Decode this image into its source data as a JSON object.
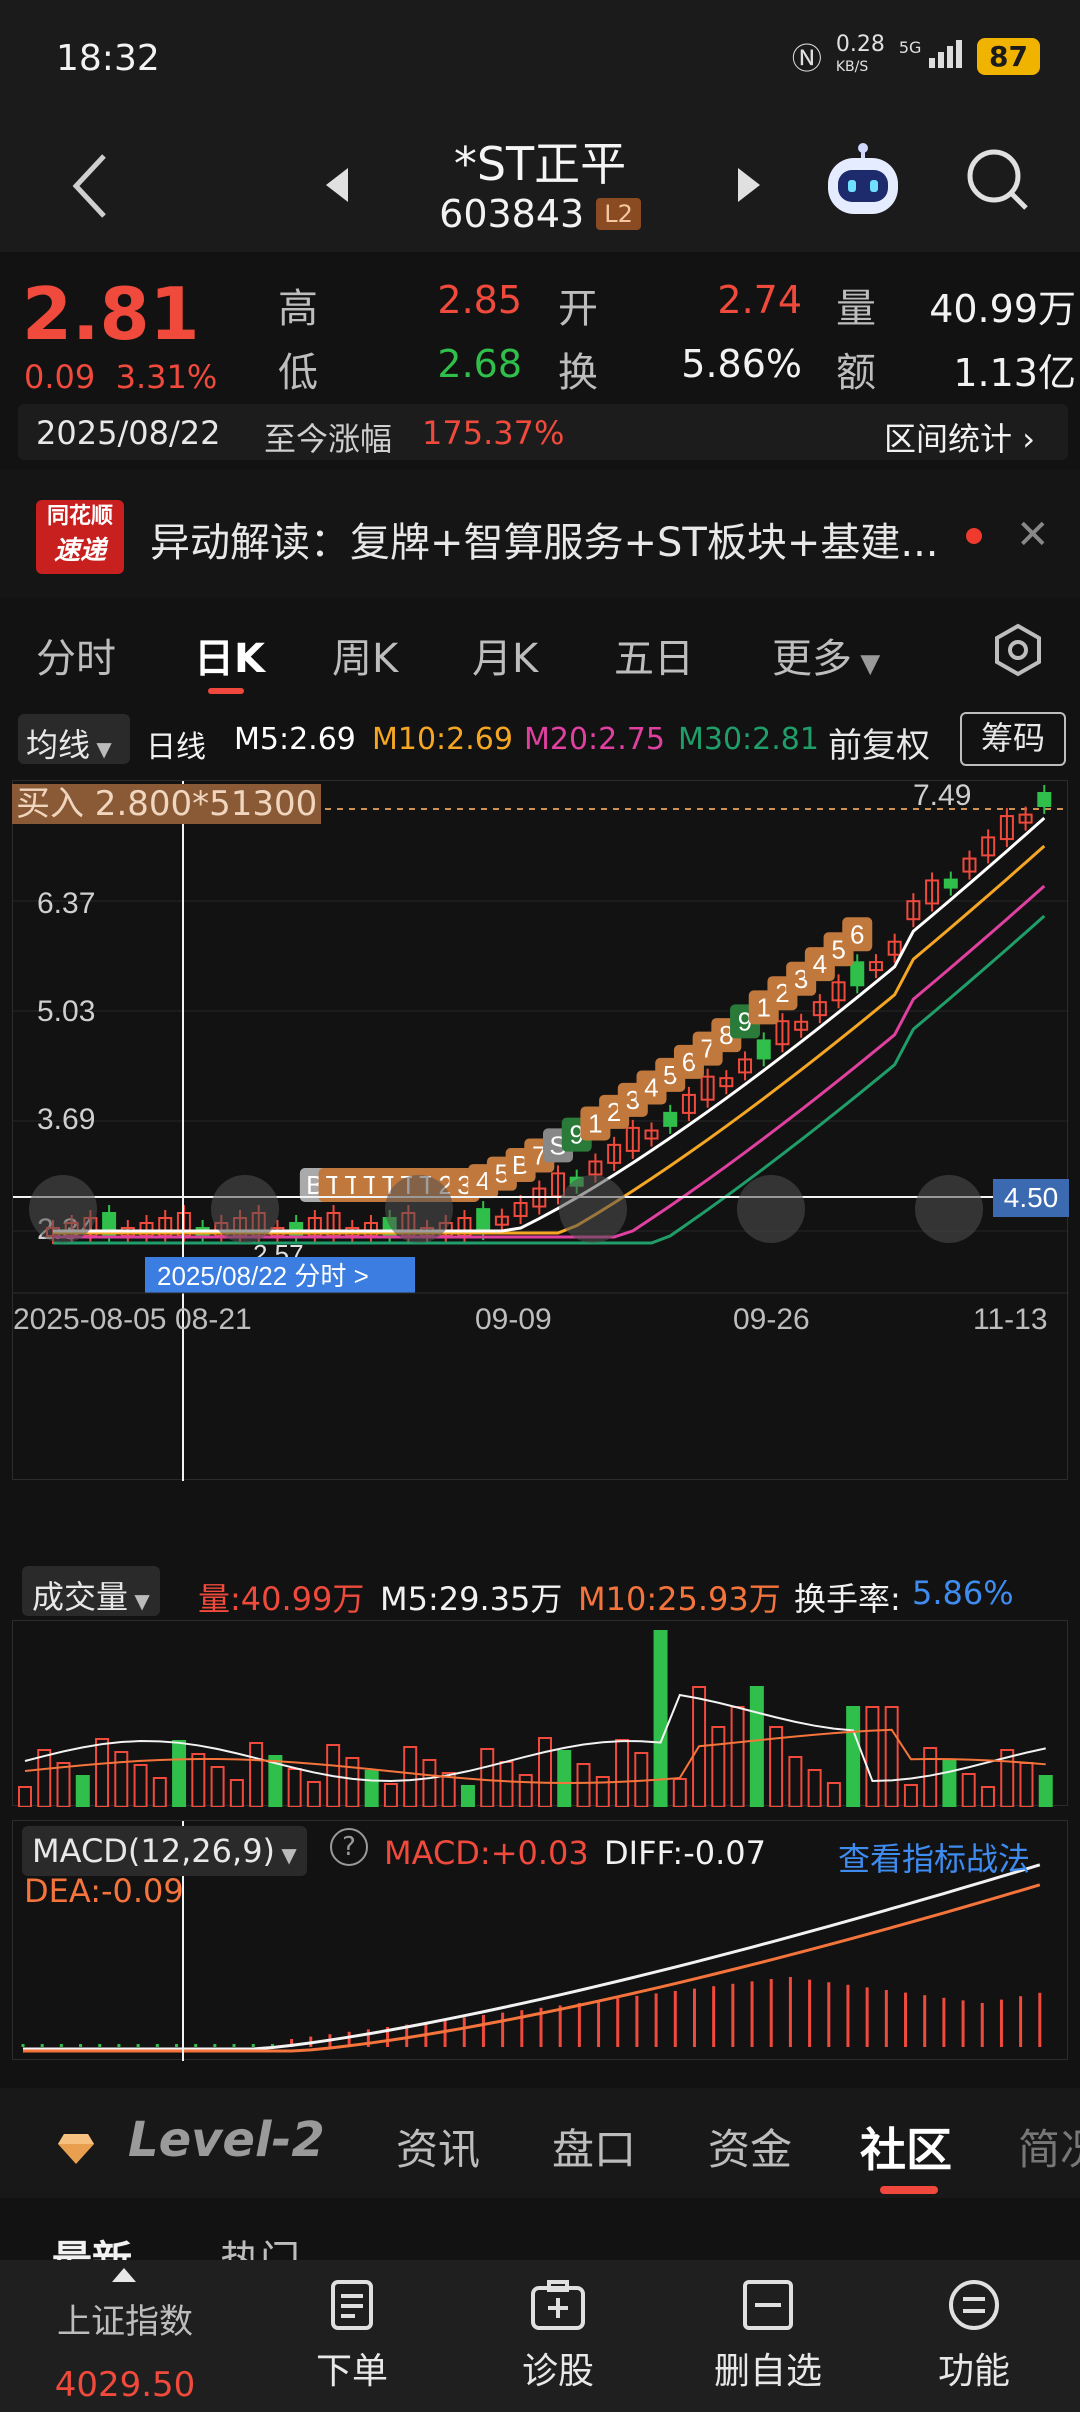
{
  "status": {
    "time": "18:32",
    "net_speed": "0.28",
    "net_unit": "KB/S",
    "signal": "5G",
    "battery": "87"
  },
  "header": {
    "name": "*ST正平",
    "code": "603843",
    "level": "L2"
  },
  "quote": {
    "price": "2.81",
    "change": "0.09",
    "change_pct": "3.31%",
    "high_label": "高",
    "high": "2.85",
    "open_label": "开",
    "open": "2.74",
    "vol_label": "量",
    "vol": "40.99万",
    "low_label": "低",
    "low": "2.68",
    "turn_label": "换",
    "turn": "5.86%",
    "amt_label": "额",
    "amt": "1.13亿",
    "date": "2025/08/22",
    "gain_label": "至今涨幅",
    "gain": "175.37%",
    "range_stats": "区间统计"
  },
  "news": {
    "logo_top": "同花顺",
    "logo_bottom": "速递",
    "text": "异动解读：复牌+智算服务+ST板块+基建..."
  },
  "period_tabs": [
    "分时",
    "日K",
    "周K",
    "月K",
    "五日",
    "更多"
  ],
  "ma_row": {
    "select": "均线",
    "period": "日线",
    "m5": "M5:2.69",
    "m10": "M10:2.69",
    "m20": "M20:2.75",
    "m30": "M30:2.81",
    "adjust": "前复权",
    "chips": "筹码"
  },
  "kline": {
    "buy_label": "买入 2.800*51300",
    "y_labels": [
      "7.49",
      "6.37",
      "5.03",
      "3.69",
      "2.34"
    ],
    "cross_price": "4.50",
    "low_marker": "2.57",
    "date_tooltip": "2025/08/22 分时 >",
    "x_labels": [
      "2025-08-05",
      "08-21",
      "09-09",
      "09-26",
      "11-13"
    ],
    "markers": [
      "B",
      "T",
      "T",
      "T",
      "T",
      "T",
      "T",
      "2",
      "3",
      "4",
      "5",
      "B",
      "7",
      "S",
      "9",
      "1",
      "2",
      "3",
      "4",
      "5",
      "6",
      "7",
      "8",
      "9",
      "1",
      "2",
      "3",
      "4",
      "5",
      "6"
    ]
  },
  "volume": {
    "select": "成交量",
    "vol": "量:40.99万",
    "m5": "M5:29.35万",
    "m10": "M10:25.93万",
    "turn_label": "换手率:",
    "turn": "5.86%"
  },
  "macd": {
    "select": "MACD(12,26,9)",
    "help": "?",
    "macd": "MACD:+0.03",
    "diff": "DIFF:-0.07",
    "link": "查看指标战法",
    "dea": "DEA:-0.09"
  },
  "sub_tabs": [
    "Level-2",
    "资讯",
    "盘口",
    "资金",
    "社区",
    "简况"
  ],
  "peek": [
    "最新",
    "热门"
  ],
  "bottom_nav": {
    "index_name": "上证指数",
    "index_value": "4029.50",
    "items": [
      "下单",
      "诊股",
      "删自选",
      "功能"
    ]
  },
  "colors": {
    "red": "#f04a3c",
    "green": "#2fbf4a",
    "ma5": "#ffffff",
    "ma10": "#f5a623",
    "ma20": "#e040a0",
    "ma30": "#1f9e6a",
    "accent_blue": "#3b7de0"
  }
}
